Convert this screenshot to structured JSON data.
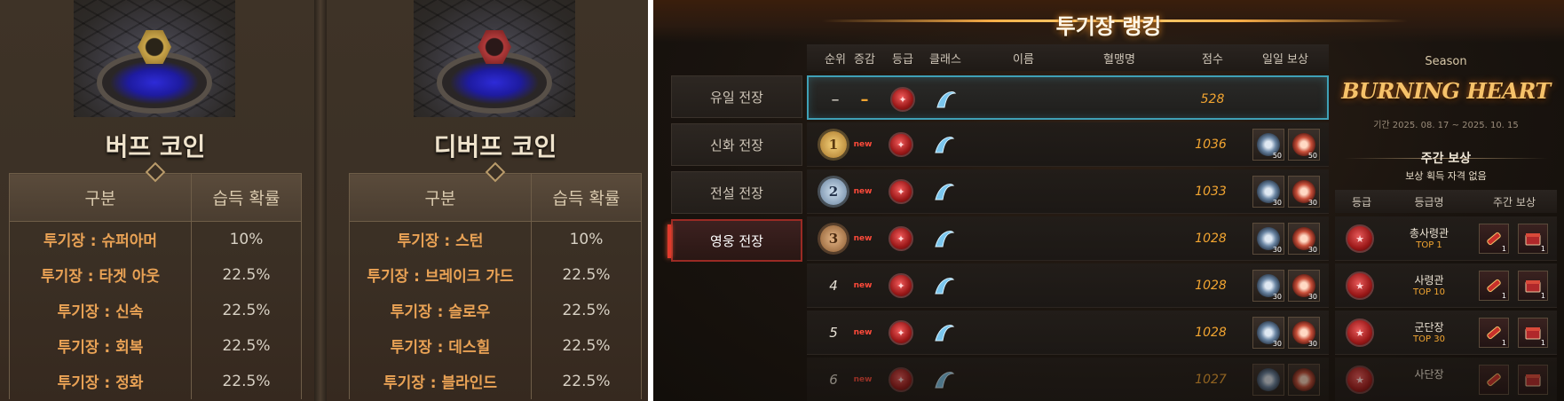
{
  "left": {
    "buff": {
      "title": "버프 코인",
      "headers": [
        "구분",
        "습득 확률"
      ],
      "rows": [
        {
          "name": "투기장 : 슈퍼아머",
          "prob": "10%"
        },
        {
          "name": "투기장 : 타겟 아웃",
          "prob": "22.5%"
        },
        {
          "name": "투기장 : 신속",
          "prob": "22.5%"
        },
        {
          "name": "투기장 : 회복",
          "prob": "22.5%"
        },
        {
          "name": "투기장 : 정화",
          "prob": "22.5%"
        }
      ]
    },
    "debuff": {
      "title": "디버프 코인",
      "headers": [
        "구분",
        "습득 확률"
      ],
      "rows": [
        {
          "name": "투기장 : 스턴",
          "prob": "10%"
        },
        {
          "name": "투기장 : 브레이크 가드",
          "prob": "22.5%"
        },
        {
          "name": "투기장 : 슬로우",
          "prob": "22.5%"
        },
        {
          "name": "투기장 : 데스힐",
          "prob": "22.5%"
        },
        {
          "name": "투기장 : 블라인드",
          "prob": "22.5%"
        }
      ]
    }
  },
  "right": {
    "title": "투기장 랭킹",
    "tabs": [
      "유일 전장",
      "신화 전장",
      "전설 전장",
      "영웅 전장"
    ],
    "active_tab": "영웅 전장",
    "columns": [
      "순위",
      "증감",
      "등급",
      "클래스",
      "이름",
      "혈맹명",
      "점수",
      "일일 보상"
    ],
    "my_row": {
      "rank": "–",
      "change": "–",
      "score": "528"
    },
    "rows": [
      {
        "rank": "1",
        "change": "new",
        "score": "1036",
        "reward_qty": [
          "50",
          "50"
        ]
      },
      {
        "rank": "2",
        "change": "new",
        "score": "1033",
        "reward_qty": [
          "30",
          "30"
        ]
      },
      {
        "rank": "3",
        "change": "new",
        "score": "1028",
        "reward_qty": [
          "30",
          "30"
        ]
      },
      {
        "rank": "4",
        "change": "new",
        "score": "1028",
        "reward_qty": [
          "30",
          "30"
        ]
      },
      {
        "rank": "5",
        "change": "new",
        "score": "1028",
        "reward_qty": [
          "30",
          "30"
        ]
      },
      {
        "rank": "6",
        "change": "new",
        "score": "1027",
        "reward_qty": [
          "",
          ""
        ]
      }
    ],
    "season": {
      "label": "Season",
      "name": "BURNING HEART",
      "period": "기간 2025. 08. 17 ~ 2025. 10. 15"
    },
    "weekly": {
      "title": "주간 보상",
      "note": "보상 획득 자격 없음",
      "columns": [
        "등급",
        "등급명",
        "주간 보상"
      ],
      "rows": [
        {
          "name": "총사령관",
          "top": "TOP 1",
          "qty": [
            "1",
            "1"
          ]
        },
        {
          "name": "사령관",
          "top": "TOP 10",
          "qty": [
            "1",
            "1"
          ]
        },
        {
          "name": "군단장",
          "top": "TOP 30",
          "qty": [
            "1",
            "1"
          ]
        },
        {
          "name": "사단장",
          "top": "",
          "qty": [
            "",
            ""
          ]
        }
      ]
    }
  },
  "colors": {
    "accent_orange": "#f2a531",
    "active_red": "#e03a2c",
    "my_row_cyan": "#3fa0b6",
    "prob_name": "#e9a255"
  }
}
